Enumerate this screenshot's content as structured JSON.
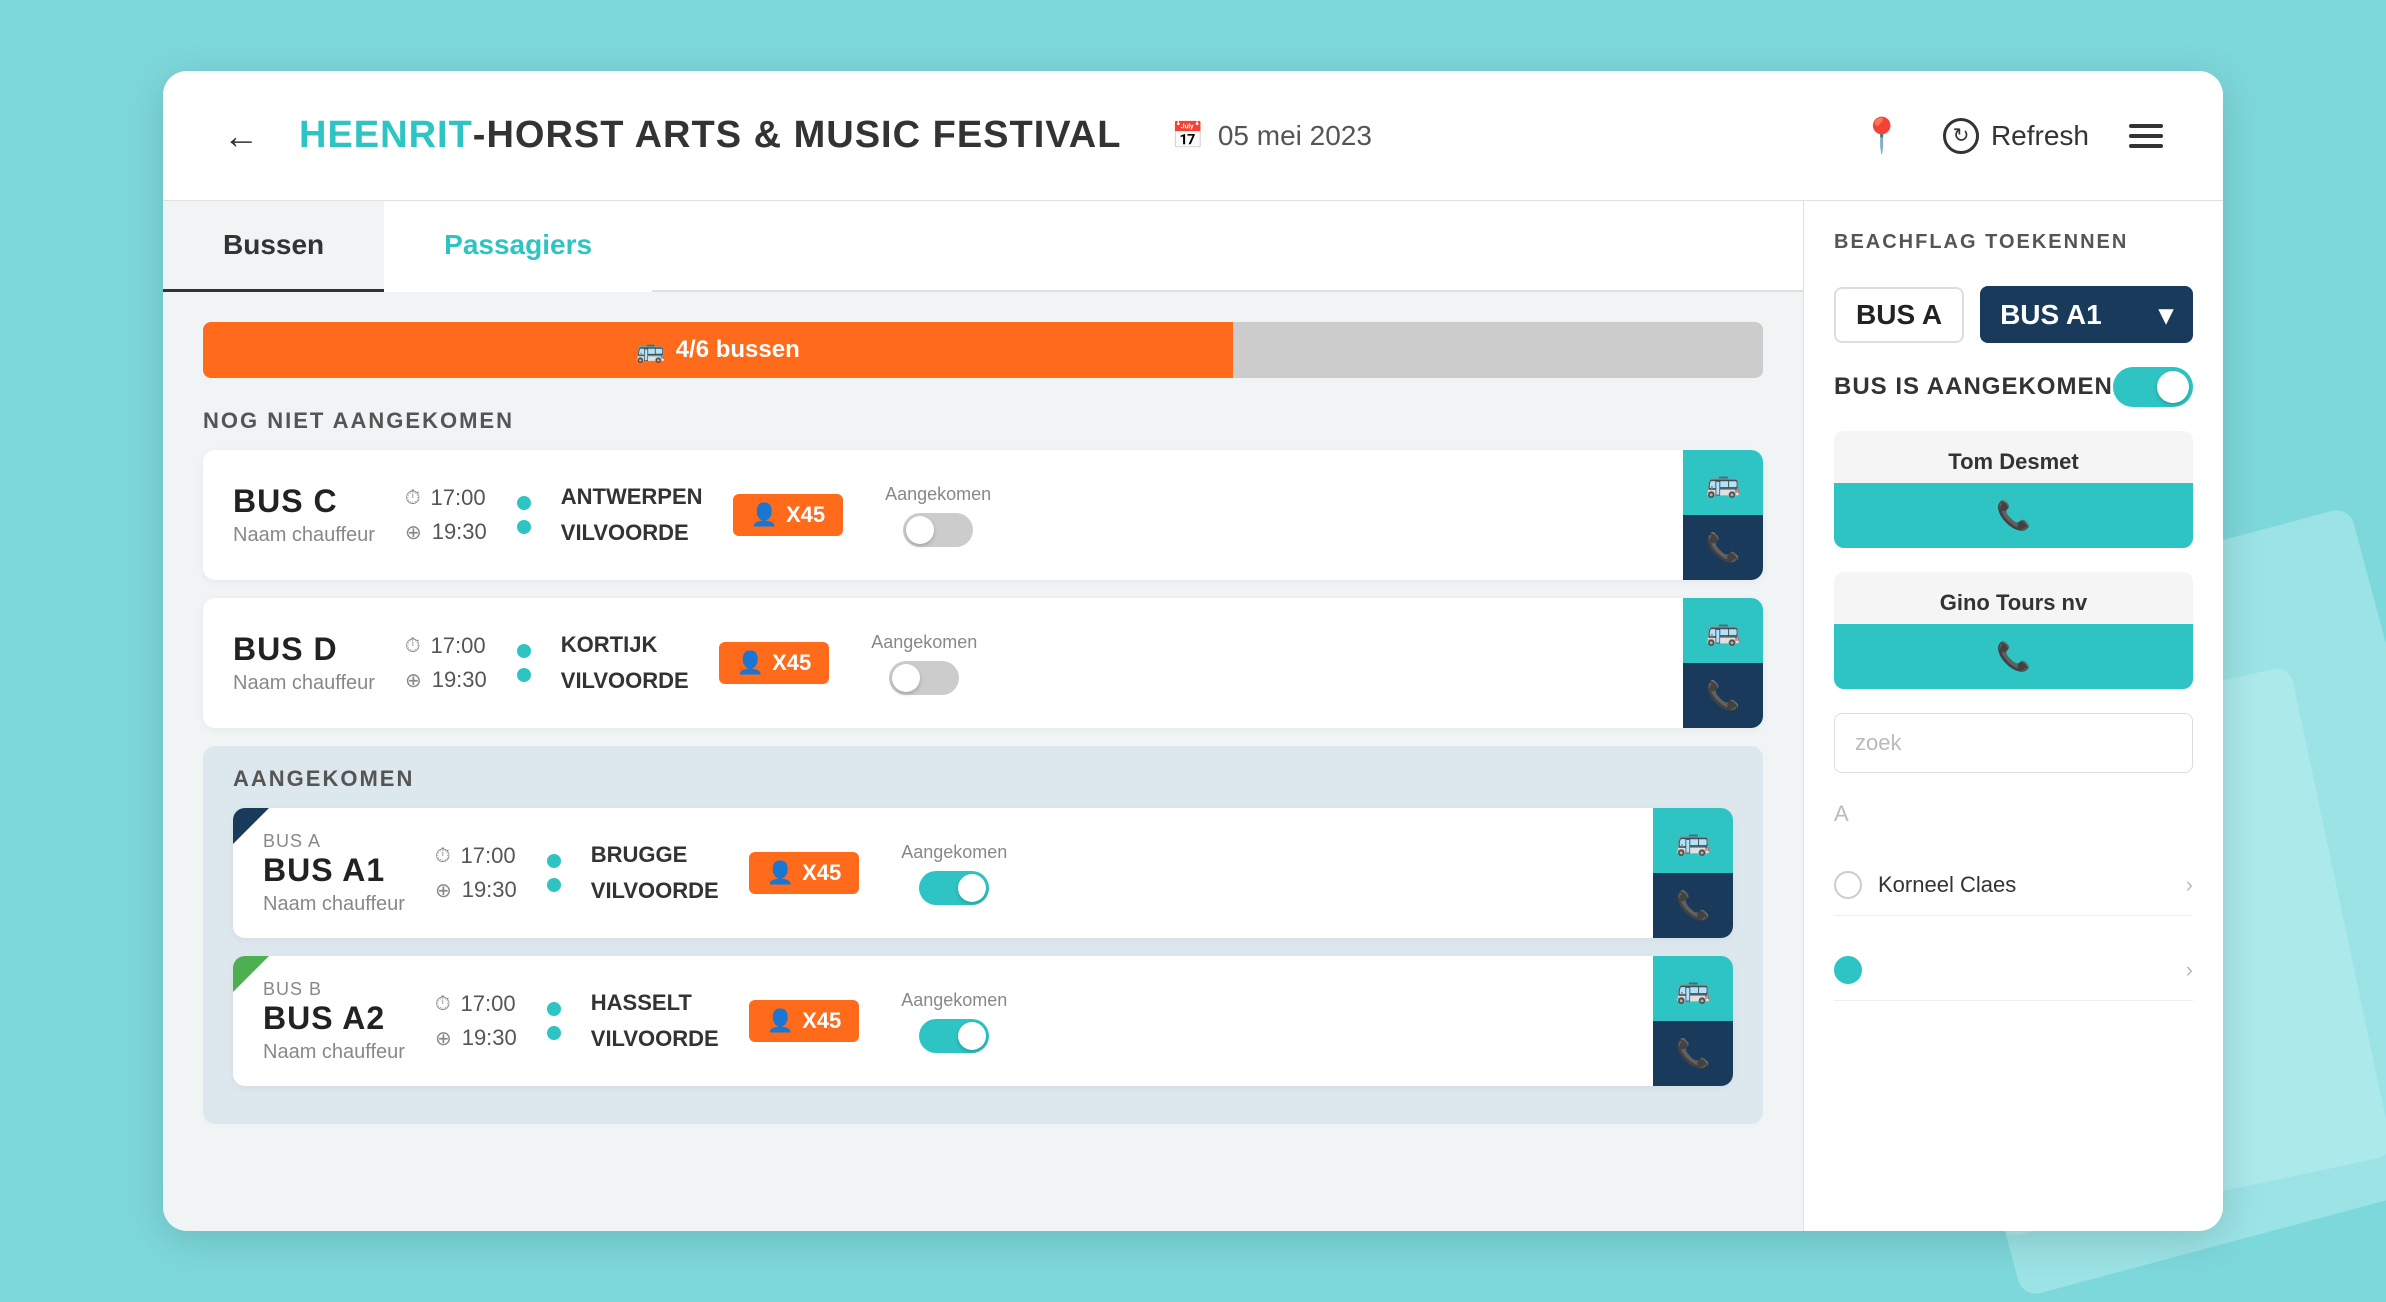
{
  "header": {
    "back_label": "←",
    "title_accent": "HEENRIT",
    "title_separator": " - ",
    "title_rest": "HORST ARTS & MUSIC FESTIVAL",
    "date_label": "05 mei 2023",
    "refresh_label": "Refresh"
  },
  "tabs": [
    {
      "label": "Bussen",
      "active": true
    },
    {
      "label": "Passagiers",
      "active": false
    }
  ],
  "progress": {
    "label": "4/6 bussen",
    "fill_percent": 66
  },
  "not_arrived_section": {
    "header": "NOG NIET AANGEKOMEN",
    "buses": [
      {
        "name": "BUS C",
        "driver": "Naam chauffeur",
        "depart_time": "17:00",
        "arrive_time": "19:30",
        "stop1": "ANTWERPEN",
        "stop2": "VILVOORDE",
        "passengers": "X45",
        "arrived": false
      },
      {
        "name": "BUS D",
        "driver": "Naam chauffeur",
        "depart_time": "17:00",
        "arrive_time": "19:30",
        "stop1": "KORTIJK",
        "stop2": "VILVOORDE",
        "passengers": "X45",
        "arrived": false
      }
    ]
  },
  "arrived_section": {
    "header": "AANGEKOMEN",
    "buses": [
      {
        "name": "BUS A1",
        "sub_label": "BUS A",
        "driver": "Naam chauffeur",
        "depart_time": "17:00",
        "arrive_time": "19:30",
        "stop1": "BRUGGE",
        "stop2": "VILVOORDE",
        "passengers": "X45",
        "arrived": true,
        "selected": true,
        "flag_color": "navy"
      },
      {
        "name": "BUS A2",
        "sub_label": "BUS B",
        "driver": "Naam chauffeur",
        "depart_time": "17:00",
        "arrive_time": "19:30",
        "stop1": "HASSELT",
        "stop2": "VILVOORDE",
        "passengers": "X45",
        "arrived": true,
        "selected": false,
        "flag_color": "green"
      }
    ]
  },
  "right_panel": {
    "beachflag_label": "BEACHFLAG TOEKENNEN",
    "bus_selector_label": "BUS A",
    "bus_selected": "BUS A1",
    "arrived_toggle_label": "BUS IS AANGEKOMEN",
    "arrived_on": true,
    "contacts": [
      {
        "name": "Tom Desmet",
        "call_icon": "📞"
      },
      {
        "name": "Gino Tours nv",
        "call_icon": "📞"
      }
    ],
    "search_placeholder": "zoek",
    "alpha_letter": "A",
    "passengers": [
      {
        "name": "Korneel Claes",
        "selected": false
      },
      {
        "name": "...",
        "selected": false
      }
    ]
  }
}
